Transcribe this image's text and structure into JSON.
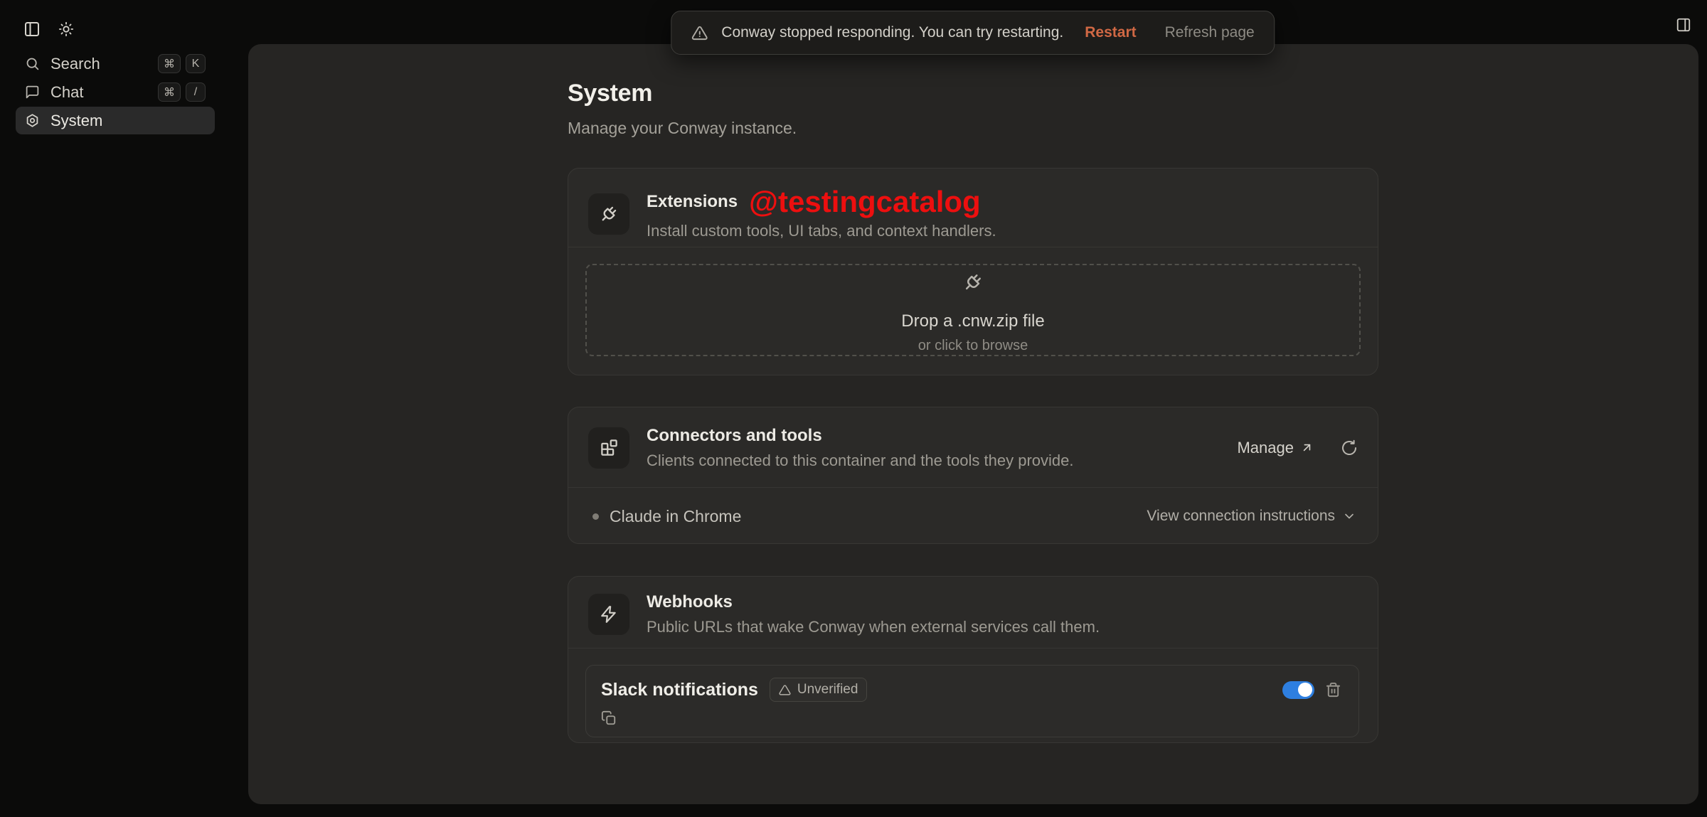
{
  "toast": {
    "message": "Conway stopped responding. You can try restarting.",
    "restart_label": "Restart",
    "refresh_label": "Refresh page"
  },
  "sidebar": {
    "items": [
      {
        "label": "Search",
        "keys": [
          "⌘",
          "K"
        ]
      },
      {
        "label": "Chat",
        "keys": [
          "⌘",
          "/"
        ]
      },
      {
        "label": "System"
      }
    ]
  },
  "page": {
    "title": "System",
    "subtitle": "Manage your Conway instance."
  },
  "extensions": {
    "title": "Extensions",
    "watermark": "@testingcatalog",
    "subtitle": "Install custom tools, UI tabs, and context handlers.",
    "dropzone": {
      "title": "Drop a .cnw.zip file",
      "subtitle": "or click to browse"
    }
  },
  "connectors": {
    "title": "Connectors and tools",
    "subtitle": "Clients connected to this container and the tools they provide.",
    "manage_label": "Manage",
    "client_name": "Claude in Chrome",
    "instructions_label": "View connection instructions"
  },
  "webhooks": {
    "title": "Webhooks",
    "subtitle": "Public URLs that wake Conway when external services call them.",
    "item": {
      "name": "Slack notifications",
      "badge": "Unverified",
      "enabled": "true"
    }
  },
  "colors": {
    "watermark_red": "#ed0f0f",
    "restart_accent": "#d06844",
    "toggle_on_blue": "#2e7fe0"
  }
}
